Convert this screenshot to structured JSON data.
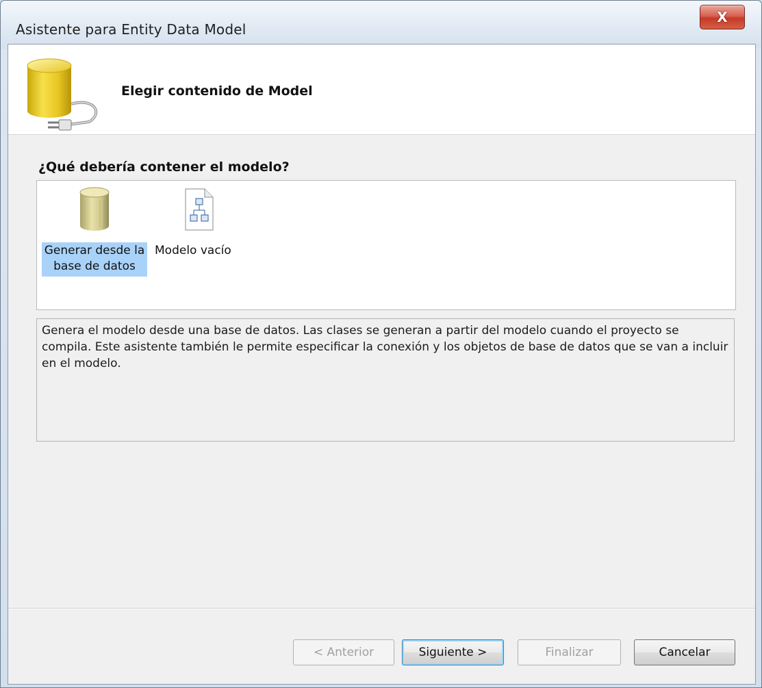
{
  "window": {
    "title": "Asistente para Entity Data Model",
    "close_label": "X"
  },
  "header": {
    "title": "Elegir contenido de Model",
    "icon": "database-plug-icon"
  },
  "question": "¿Qué debería contener el modelo?",
  "options": [
    {
      "label": "Generar desde la base de datos",
      "icon": "database-icon",
      "selected": true
    },
    {
      "label": "Modelo vacío",
      "icon": "diagram-document-icon",
      "selected": false
    }
  ],
  "description": "Genera el modelo desde una base de datos. Las clases se generan a partir del modelo cuando el proyecto se compila. Este asistente también le permite especificar la conexión y los objetos de base de datos que se van a incluir en el modelo.",
  "buttons": {
    "previous": "< Anterior",
    "next": "Siguiente >",
    "finish": "Finalizar",
    "cancel": "Cancelar"
  },
  "colors": {
    "selection": "#a9d2f8",
    "close_button": "#c63a28",
    "default_button_border": "#3c7fb1"
  }
}
